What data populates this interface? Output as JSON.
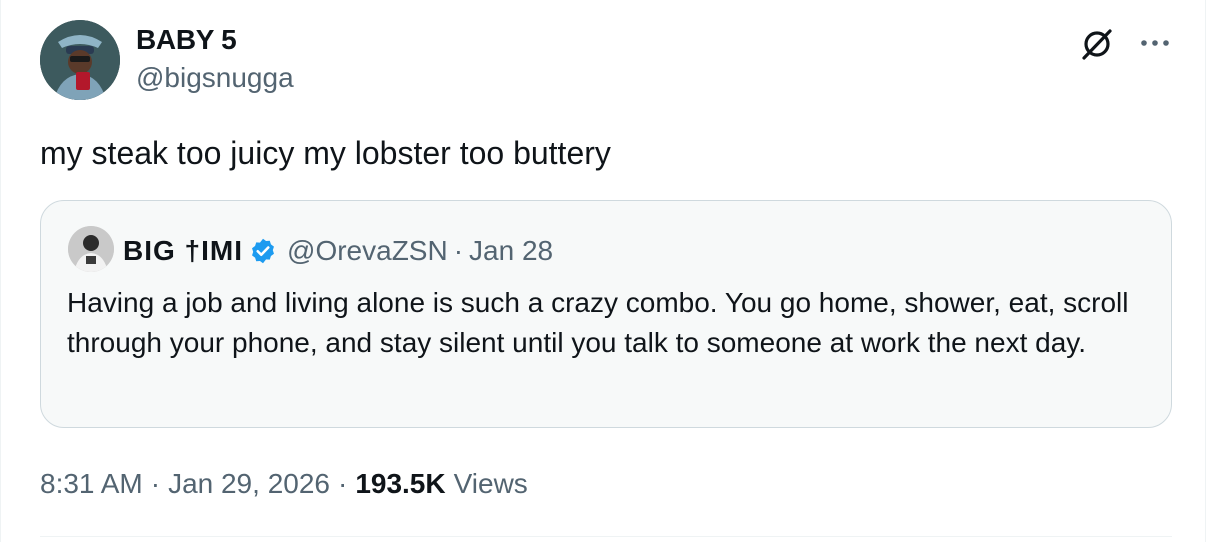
{
  "author": {
    "display_name": "BABY 5",
    "handle": "@bigsnugga"
  },
  "header_icons": {
    "grok": "grok-icon",
    "more": "more-icon"
  },
  "tweet": {
    "text": "my steak too juicy my lobster too buttery"
  },
  "quote": {
    "display_name": "BIG †IMI",
    "verified": true,
    "verified_color": "#1d9bf0",
    "handle": "@OrevaZSN",
    "separator": "·",
    "date": "Jan 28",
    "text": "Having a job and living alone is such a crazy combo. You go home, shower, eat, scroll through your phone, and stay silent until you talk to someone at work the next day."
  },
  "meta": {
    "time": "8:31 AM",
    "separator": "·",
    "date": "Jan 29, 2026",
    "views_count": "193.5K",
    "views_label": "Views"
  },
  "colors": {
    "text_primary": "#0f1419",
    "text_secondary": "#536471",
    "quote_border": "#cfd9de",
    "quote_bg": "#f7f9f9"
  }
}
